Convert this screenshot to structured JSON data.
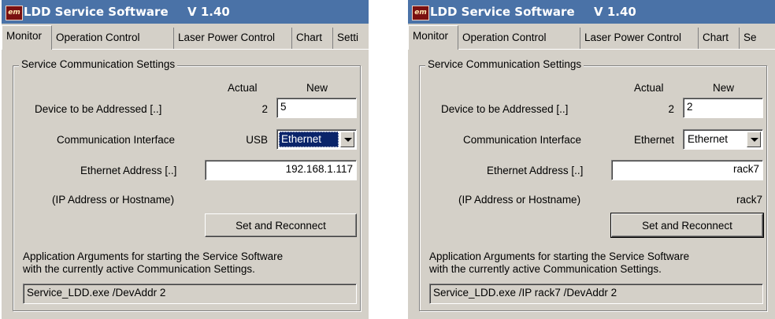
{
  "windows": [
    {
      "title": "LDD Service Software",
      "version": "V 1.40",
      "logo_text": "em",
      "tabs": [
        "Monitor",
        "Operation Control",
        "Laser Power Control",
        "Chart",
        "Setti"
      ],
      "selected_tab": "Monitor",
      "group_title": "Service Communication Settings",
      "col_actual": "Actual",
      "col_new": "New",
      "device_label": "Device to be Addressed [..]",
      "device_actual": "2",
      "device_new": "5",
      "interface_label": "Communication Interface",
      "interface_actual": "USB",
      "interface_new": "Ethernet",
      "ethernet_label": "Ethernet Address [..]",
      "ethernet_value": "192.168.1.117",
      "ip_label": "(IP Address or Hostname)",
      "ip_actual": "",
      "button": "Set and Reconnect",
      "args_text_line1": "Application Arguments for starting the Service Software",
      "args_text_line2": "with the currently active Communication Settings.",
      "args_value": "Service_LDD.exe /DevAddr 2"
    },
    {
      "title": "LDD Service Software",
      "version": "V 1.40",
      "logo_text": "em",
      "tabs": [
        "Monitor",
        "Operation Control",
        "Laser Power Control",
        "Chart",
        "Se"
      ],
      "selected_tab": "Monitor",
      "group_title": "Service Communication Settings",
      "col_actual": "Actual",
      "col_new": "New",
      "device_label": "Device to be Addressed [..]",
      "device_actual": "2",
      "device_new": "2",
      "interface_label": "Communication Interface",
      "interface_actual": "Ethernet",
      "interface_new": "Ethernet",
      "ethernet_label": "Ethernet Address [..]",
      "ethernet_value": "rack7",
      "ip_label": "(IP Address or Hostname)",
      "ip_actual": "rack7",
      "button": "Set and Reconnect",
      "args_text_line1": "Application Arguments for starting the Service Software",
      "args_text_line2": "with the currently active Communication Settings.",
      "args_value": "Service_LDD.exe /IP rack7 /DevAddr 2"
    }
  ]
}
